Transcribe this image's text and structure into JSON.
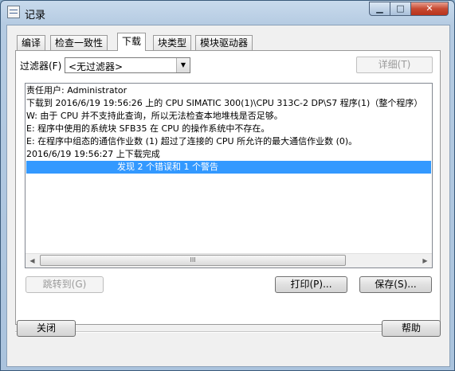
{
  "window": {
    "title": "记录",
    "minimize_label": "▁",
    "maximize_label": "□",
    "close_label": "✕"
  },
  "tabs": [
    {
      "label": "编译",
      "active": false
    },
    {
      "label": "检查一致性",
      "active": false
    },
    {
      "label": "下载",
      "active": true
    },
    {
      "label": "块类型",
      "active": false
    },
    {
      "label": "模块驱动器",
      "active": false
    }
  ],
  "filter": {
    "label": "过滤器(F)",
    "value": "<无过滤器>"
  },
  "details_button": "详细(T)",
  "log_lines": [
    "责任用户:  Administrator",
    "下载到 2016/6/19 19:56:26 上的 CPU SIMATIC 300(1)\\CPU 313C-2 DP\\S7 程序(1)（整个程序）",
    "W:   由于 CPU 并不支持此查询，所以无法检查本地堆栈是否足够。",
    "E:   程序中使用的系统块 SFB35 在 CPU 的操作系统中不存在。",
    "E:   在程序中组态的通信作业数 (1) 超过了连接的 CPU 所允许的最大通信作业数 (0)。",
    "2016/6/19 19:56:27 上下载完成",
    "发现 2 个错误和 1 个警告"
  ],
  "buttons": {
    "goto": "跳转到(G)",
    "print": "打印(P)...",
    "save": "保存(S)...",
    "close": "关闭",
    "help": "帮助"
  },
  "scrollbar": {
    "left_arrow": "◀",
    "right_arrow": "▶",
    "grip": "III"
  },
  "dropdown_arrow": "▼"
}
